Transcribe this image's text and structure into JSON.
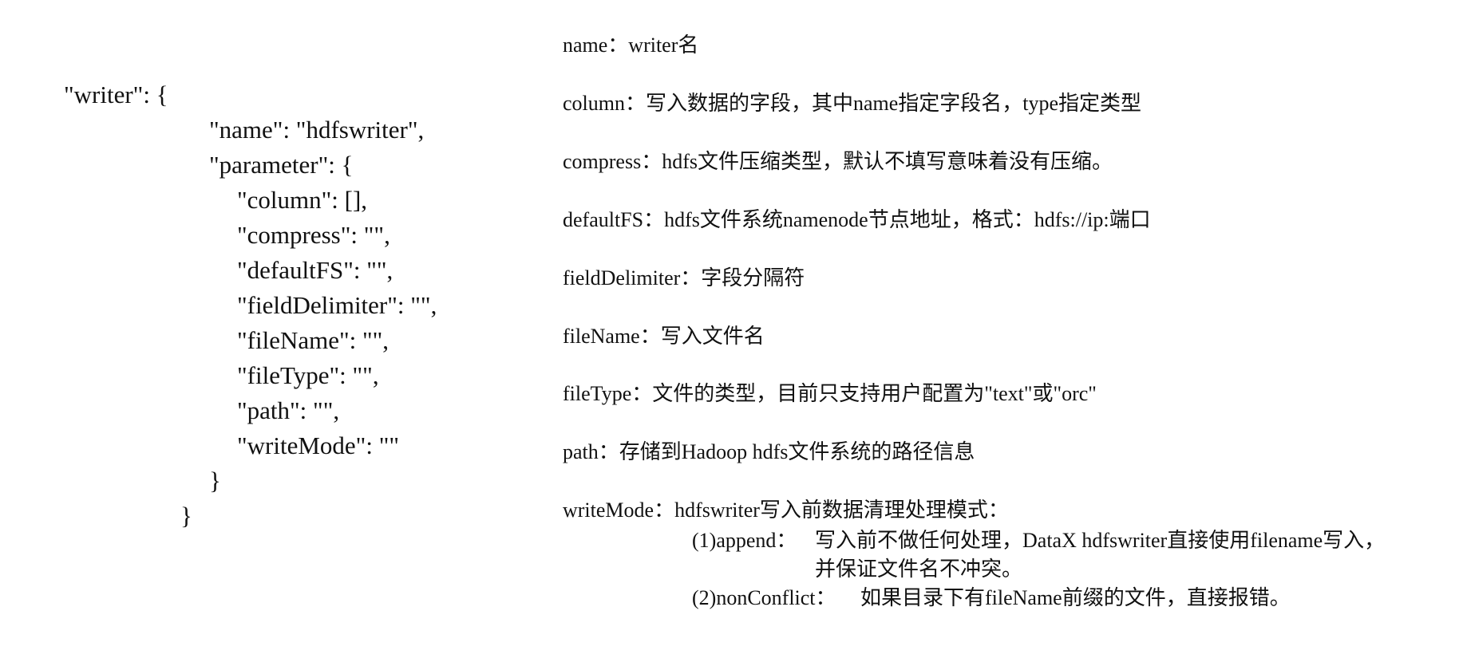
{
  "code": {
    "lines": [
      "\"writer\": {",
      "\"name\": \"hdfswriter\",",
      "\"parameter\": {",
      "\"column\": [],",
      "\"compress\": \"\",",
      "\"defaultFS\": \"\",",
      "\"fieldDelimiter\": \"\",",
      "\"fileName\": \"\",",
      "\"fileType\": \"\",",
      "\"path\": \"\",",
      "\"writeMode\": \"\"",
      "}",
      "}"
    ]
  },
  "descriptions": [
    "name：writer名",
    "column：写入数据的字段，其中name指定字段名，type指定类型",
    "compress：hdfs文件压缩类型，默认不填写意味着没有压缩。",
    "defaultFS：hdfs文件系统namenode节点地址，格式：hdfs://ip:端口",
    "fieldDelimiter：字段分隔符",
    "fileName：写入文件名",
    "fileType：文件的类型，目前只支持用户配置为\"text\"或\"orc\"",
    "path：存储到Hadoop hdfs文件系统的路径信息",
    "writeMode：hdfswriter写入前数据清理处理模式："
  ],
  "write_modes": {
    "append_label": "(1)append：",
    "append_text": "写入前不做任何处理，DataX hdfswriter直接使用filename写入，",
    "append_cont": "并保证文件名不冲突。",
    "nonconflict_label": "(2)nonConflict：",
    "nonconflict_text": "如果目录下有fileName前缀的文件，直接报错。"
  }
}
